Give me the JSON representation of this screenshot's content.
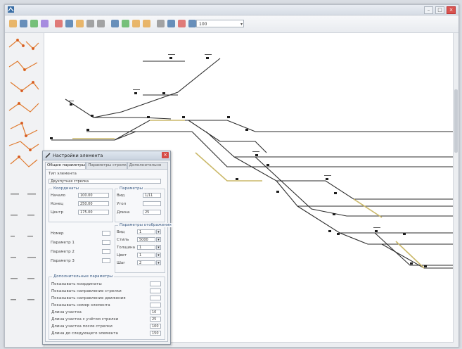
{
  "window": {
    "title": "",
    "controls": {
      "minimize": "–",
      "maximize": "□",
      "close": "×"
    }
  },
  "toolbar": {
    "zoom_value": "100",
    "icons": [
      "new-icon",
      "open-icon",
      "save-icon",
      "print-icon",
      "cut-icon",
      "copy-icon",
      "paste-icon",
      "undo-icon",
      "redo-icon",
      "select-icon",
      "pan-icon",
      "zoom-in-icon",
      "zoom-out-icon",
      "grid-icon",
      "layers-icon",
      "settings-icon",
      "help-icon"
    ]
  },
  "palette": {
    "items": [
      "switch-left-icon",
      "switch-right-icon",
      "crossover-icon",
      "junction-icon",
      "signal-icon",
      "track-end-icon",
      "double-switch-icon",
      "crossing-icon"
    ]
  },
  "dialog": {
    "title": "Настройки элемента",
    "close": "×",
    "tabs": [
      "Общие параметры",
      "Параметры стрелки",
      "Дополнительно"
    ],
    "field_type_label": "Тип элемента",
    "field_type_value": "Двухпутная стрелка",
    "group_coords": "Координаты",
    "coords_labels": [
      "Начало",
      "Конец",
      "Центр"
    ],
    "coords_values": [
      "100.00",
      "250.00",
      "175.00"
    ],
    "group_params": "Параметры",
    "params_labels": [
      "Вид",
      "Угол",
      "Длина"
    ],
    "params_values": [
      "1/11",
      "",
      "25"
    ],
    "group_more": "Параметры отображения",
    "more_labels": [
      "Вид",
      "Стиль",
      "Толщина",
      "Цвет",
      "Шаг"
    ],
    "more_values": [
      "1",
      "5000",
      "1",
      "1",
      "2"
    ],
    "left_labels": [
      "Номер",
      "Параметр 1",
      "Параметр 2",
      "Параметр 3"
    ],
    "group_bottom": "Дополнительные параметры",
    "bottom_items": [
      "Показывать координаты",
      "Показывать направление стрелки",
      "Показывать направление движения",
      "Показывать номер элемента",
      "Длина участка",
      "Длина участка с учётом стрелки",
      "Длина участка после стрелки",
      "Длина до следующего элемента"
    ],
    "bottom_values": [
      "",
      "",
      "",
      "",
      "10",
      "25",
      "100",
      "150"
    ]
  }
}
